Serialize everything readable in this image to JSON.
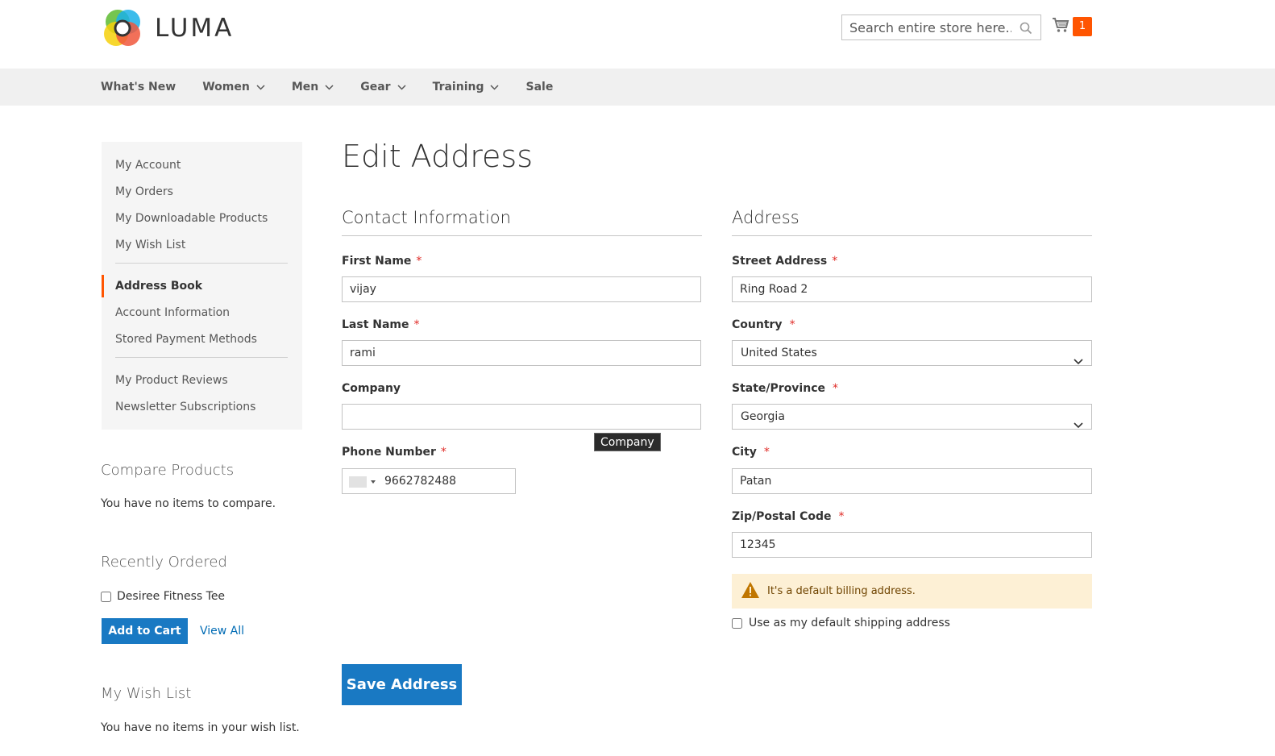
{
  "header": {
    "logo_text": "LUMA",
    "search_placeholder": "Search entire store here...",
    "cart_count": "1"
  },
  "nav": {
    "items": [
      {
        "label": "What's New",
        "has_submenu": false
      },
      {
        "label": "Women",
        "has_submenu": true
      },
      {
        "label": "Men",
        "has_submenu": true
      },
      {
        "label": "Gear",
        "has_submenu": true
      },
      {
        "label": "Training",
        "has_submenu": true
      },
      {
        "label": "Sale",
        "has_submenu": false
      }
    ]
  },
  "sidebar": {
    "items": [
      "My Account",
      "My Orders",
      "My Downloadable Products",
      "My Wish List",
      "Address Book",
      "Account Information",
      "Stored Payment Methods",
      "My Product Reviews",
      "Newsletter Subscriptions"
    ],
    "current": "Address Book",
    "compare": {
      "title": "Compare Products",
      "text": "You have no items to compare."
    },
    "recent": {
      "title": "Recently Ordered",
      "item": "Desiree Fitness Tee",
      "add_label": "Add to Cart",
      "view_all": "View All"
    },
    "wishlist": {
      "title": "My Wish List",
      "text": "You have no items in your wish list."
    }
  },
  "main": {
    "title": "Edit Address",
    "contact": {
      "title": "Contact Information",
      "first_name_label": "First Name",
      "first_name": "vijay",
      "last_name_label": "Last Name",
      "last_name": "rami",
      "company_label": "Company",
      "company": "",
      "phone_label": "Phone Number",
      "phone": "9662782488"
    },
    "tooltip": "Company",
    "address": {
      "title": "Address",
      "street_label": "Street Address",
      "street": "Ring Road 2",
      "country_label": "Country",
      "country": "United States",
      "state_label": "State/Province",
      "state": "Georgia",
      "city_label": "City",
      "city": "Patan",
      "zip_label": "Zip/Postal Code",
      "zip": "12345",
      "notice": "It's a default billing address.",
      "default_shipping_label": "Use as my default shipping address"
    },
    "save_label": "Save Address"
  },
  "colors": {
    "primary": "#1979c3",
    "accent": "#ff5501",
    "notice_bg": "#fdf0d5"
  }
}
